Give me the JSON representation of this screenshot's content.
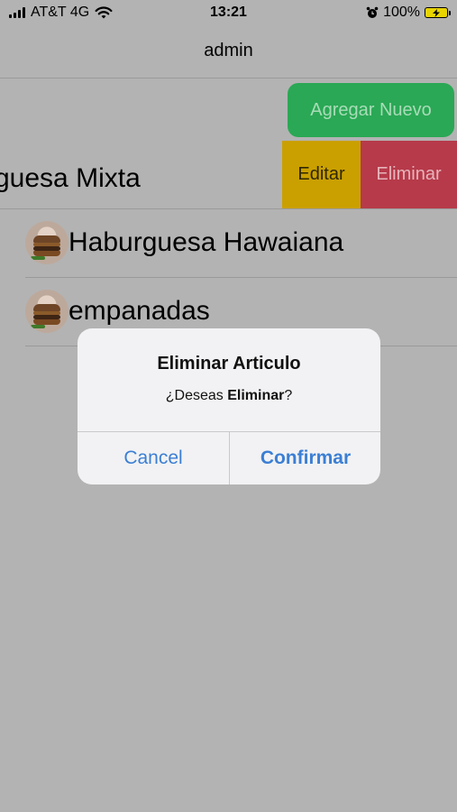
{
  "status_bar": {
    "carrier": "AT&T 4G",
    "time": "13:21",
    "battery": "100%"
  },
  "nav": {
    "title": "admin"
  },
  "add_button": {
    "label": "Agregar Nuevo"
  },
  "list": {
    "items": [
      {
        "label": "guesa Mixta",
        "actions": {
          "edit": "Editar",
          "delete": "Eliminar"
        }
      },
      {
        "label": "Haburguesa Hawaiana"
      },
      {
        "label": "empanadas"
      }
    ]
  },
  "dialog": {
    "title": "Eliminar Articulo",
    "message_prefix": "¿Deseas ",
    "message_bold": "Eliminar",
    "message_suffix": "?",
    "cancel": "Cancel",
    "confirm": "Confirmar"
  },
  "colors": {
    "add_button": "#2aa855",
    "edit_action": "#caa000",
    "delete_action": "#b63a4a",
    "dialog_buttons": "#3b7fd4"
  },
  "icons": [
    "signal-icon",
    "wifi-icon",
    "alarm-icon",
    "battery-icon",
    "burger-image"
  ]
}
